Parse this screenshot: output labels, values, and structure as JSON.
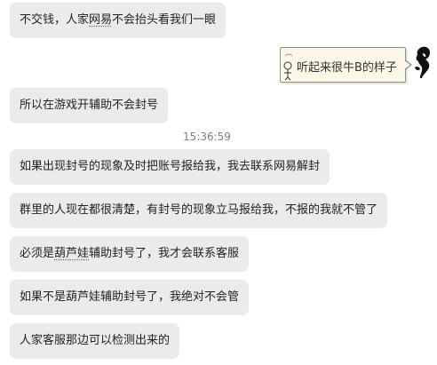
{
  "messages": [
    {
      "parts": [
        {
          "text": "不交钱，人家"
        },
        {
          "text": "网易",
          "underline": true
        },
        {
          "text": "不会抬头看我们一眼"
        }
      ]
    },
    {
      "parts": [
        {
          "text": "所以在游戏开辅助不会封号"
        }
      ]
    },
    {
      "parts": [
        {
          "text": "如果出现封号的现象及时把账号报给我，我去联系网易解封"
        }
      ]
    },
    {
      "parts": [
        {
          "text": "群里的人现在都很清楚，有封号的现象立马报给我，不报的我就不管了"
        }
      ]
    },
    {
      "parts": [
        {
          "text": "必须是"
        },
        {
          "text": "葫芦娃",
          "underline": true
        },
        {
          "text": "辅助封号了，我才会联系客服"
        }
      ]
    },
    {
      "parts": [
        {
          "text": "如果不是葫芦娃辅助封号了，我绝对不会管"
        }
      ]
    },
    {
      "parts": [
        {
          "text": "人家客服那边可以检测出来的"
        }
      ]
    }
  ],
  "self_message": {
    "text": "听起来很牛B的样子"
  },
  "timestamp": "15:36:59",
  "avatar_icon": "person-silhouette-icon",
  "colors": {
    "bubble_bg": "#ebebeb",
    "self_bubble_bg": "#fbf8e8",
    "timestamp_text": "#7d7d7d"
  }
}
